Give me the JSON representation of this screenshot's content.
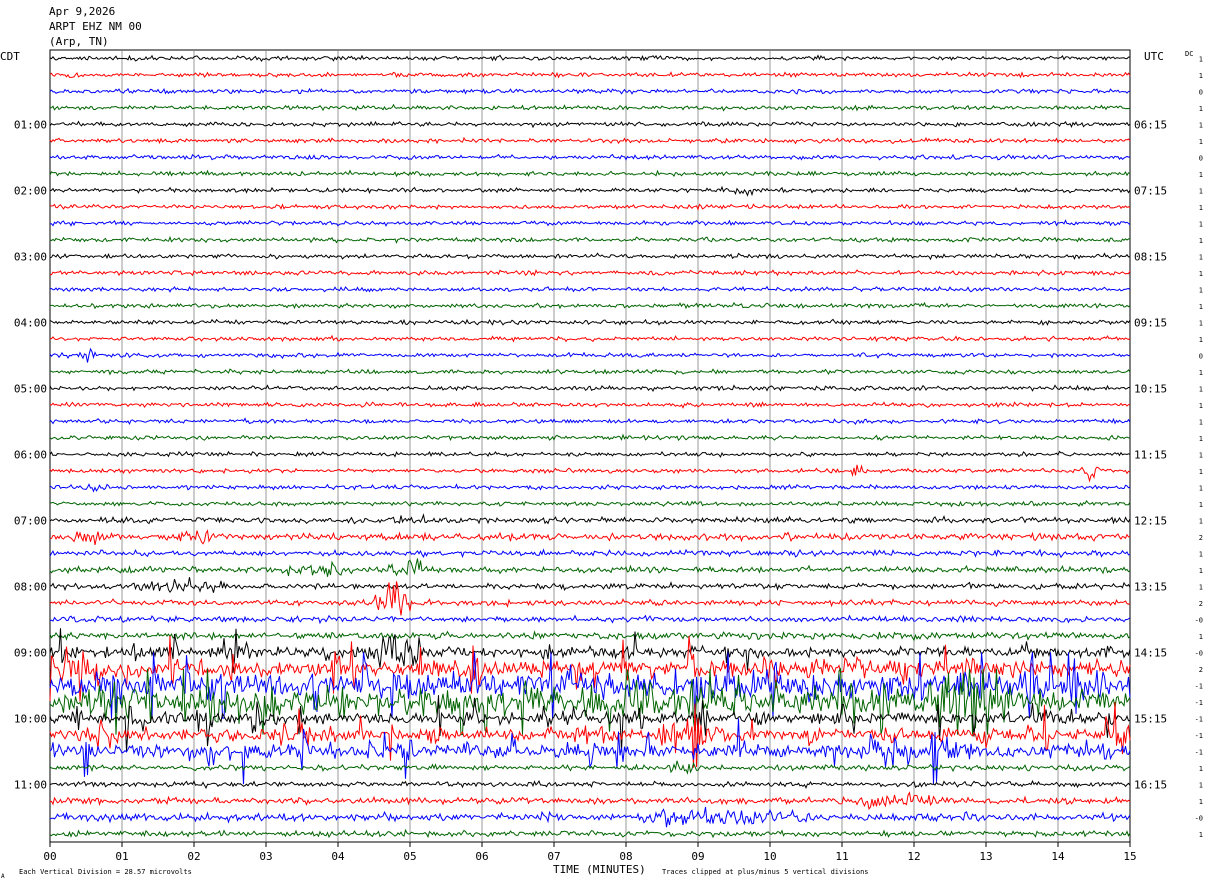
{
  "header": {
    "date": "Apr 9,2026",
    "station": "ARPT EHZ NM 00",
    "location": "(Arp, TN)"
  },
  "left_axis_label": "CDT",
  "right_axis_label": "UTC",
  "dc_label": "DC",
  "footer": {
    "division_note": "Each Vertical Division =   28.57 microvolts",
    "clip_note": "Traces clipped at plus/minus 5 vertical divisions",
    "corner_mark": "A"
  },
  "colors": {
    "cycle": [
      "#000000",
      "#ff0000",
      "#0000ff",
      "#006400"
    ],
    "grid": "#808080"
  },
  "chart_data": {
    "type": "line",
    "title": "",
    "xlabel": "TIME (MINUTES)",
    "ylabel": "",
    "x_ticks": [
      "00",
      "01",
      "02",
      "03",
      "04",
      "05",
      "06",
      "07",
      "08",
      "09",
      "10",
      "11",
      "12",
      "13",
      "14",
      "15"
    ],
    "xlim": [
      0,
      15
    ],
    "trace_minutes": 15,
    "row_count": 48,
    "left_time_labels": [
      {
        "row": 4,
        "label": "01:00"
      },
      {
        "row": 8,
        "label": "02:00"
      },
      {
        "row": 12,
        "label": "03:00"
      },
      {
        "row": 16,
        "label": "04:00"
      },
      {
        "row": 20,
        "label": "05:00"
      },
      {
        "row": 24,
        "label": "06:00"
      },
      {
        "row": 28,
        "label": "07:00"
      },
      {
        "row": 32,
        "label": "08:00"
      },
      {
        "row": 36,
        "label": "09:00"
      },
      {
        "row": 40,
        "label": "10:00"
      },
      {
        "row": 44,
        "label": "11:00"
      }
    ],
    "right_time_labels": [
      {
        "row": 4,
        "label": "06:15"
      },
      {
        "row": 8,
        "label": "07:15"
      },
      {
        "row": 12,
        "label": "08:15"
      },
      {
        "row": 16,
        "label": "09:15"
      },
      {
        "row": 20,
        "label": "10:15"
      },
      {
        "row": 24,
        "label": "11:15"
      },
      {
        "row": 28,
        "label": "12:15"
      },
      {
        "row": 32,
        "label": "13:15"
      },
      {
        "row": 36,
        "label": "14:15"
      },
      {
        "row": 40,
        "label": "15:15"
      },
      {
        "row": 44,
        "label": "16:15"
      }
    ],
    "dc_offsets": [
      "1",
      "1",
      "0",
      "1",
      "1",
      "1",
      "0",
      "1",
      "1",
      "1",
      "1",
      "1",
      "1",
      "1",
      "1",
      "1",
      "1",
      "1",
      "0",
      "1",
      "1",
      "1",
      "1",
      "1",
      "1",
      "1",
      "1",
      "1",
      "1",
      "2",
      "1",
      "1",
      "1",
      "2",
      "-0",
      "1",
      "-0",
      "2",
      "-1",
      "-1",
      "-1",
      "-1",
      "-1",
      "1",
      "1",
      "1",
      "-0",
      "1"
    ],
    "noise_level": [
      1,
      1,
      1,
      1,
      1,
      1,
      1,
      1,
      1,
      1,
      1,
      1,
      1,
      1,
      1,
      1,
      1,
      1,
      1,
      1,
      1,
      1,
      1,
      1,
      1,
      1,
      1,
      1,
      1.3,
      1.6,
      1.3,
      1.4,
      1.3,
      1.3,
      1.4,
      1.6,
      2.5,
      4,
      6,
      6,
      3,
      3,
      3,
      1.3,
      1.2,
      1.5,
      1.8,
      1.3
    ],
    "events": [
      {
        "row": 1,
        "start_min": 0.2,
        "end_min": 0.4,
        "amp": 1.5
      },
      {
        "row": 8,
        "start_min": 9.3,
        "end_min": 9.8,
        "amp": 2
      },
      {
        "row": 18,
        "start_min": 0.4,
        "end_min": 0.7,
        "amp": 2
      },
      {
        "row": 25,
        "start_min": 11.1,
        "end_min": 11.3,
        "amp": 3
      },
      {
        "row": 25,
        "start_min": 14.3,
        "end_min": 14.6,
        "amp": 3
      },
      {
        "row": 26,
        "start_min": 0.5,
        "end_min": 0.9,
        "amp": 2.5
      },
      {
        "row": 28,
        "start_min": 4.7,
        "end_min": 5.3,
        "amp": 2
      },
      {
        "row": 29,
        "start_min": 0.3,
        "end_min": 1.0,
        "amp": 3
      },
      {
        "row": 29,
        "start_min": 1.7,
        "end_min": 2.3,
        "amp": 3
      },
      {
        "row": 31,
        "start_min": 3.2,
        "end_min": 4.2,
        "amp": 3
      },
      {
        "row": 31,
        "start_min": 4.7,
        "end_min": 5.3,
        "amp": 4
      },
      {
        "row": 32,
        "start_min": 1.0,
        "end_min": 2.5,
        "amp": 2.5
      },
      {
        "row": 33,
        "start_min": 4.5,
        "end_min": 5.0,
        "amp": 12
      },
      {
        "row": 36,
        "start_min": 4.5,
        "end_min": 5.2,
        "amp": 10
      },
      {
        "row": 39,
        "start_min": 12.2,
        "end_min": 13.0,
        "amp": 9
      },
      {
        "row": 41,
        "start_min": 8.5,
        "end_min": 9.2,
        "amp": 11
      },
      {
        "row": 42,
        "start_min": 12.2,
        "end_min": 12.8,
        "amp": 5
      },
      {
        "row": 43,
        "start_min": 8.6,
        "end_min": 9.0,
        "amp": 4
      },
      {
        "row": 45,
        "start_min": 11.0,
        "end_min": 12.5,
        "amp": 3
      },
      {
        "row": 46,
        "start_min": 8.2,
        "end_min": 10.5,
        "amp": 4
      }
    ],
    "grid": "vertical"
  }
}
